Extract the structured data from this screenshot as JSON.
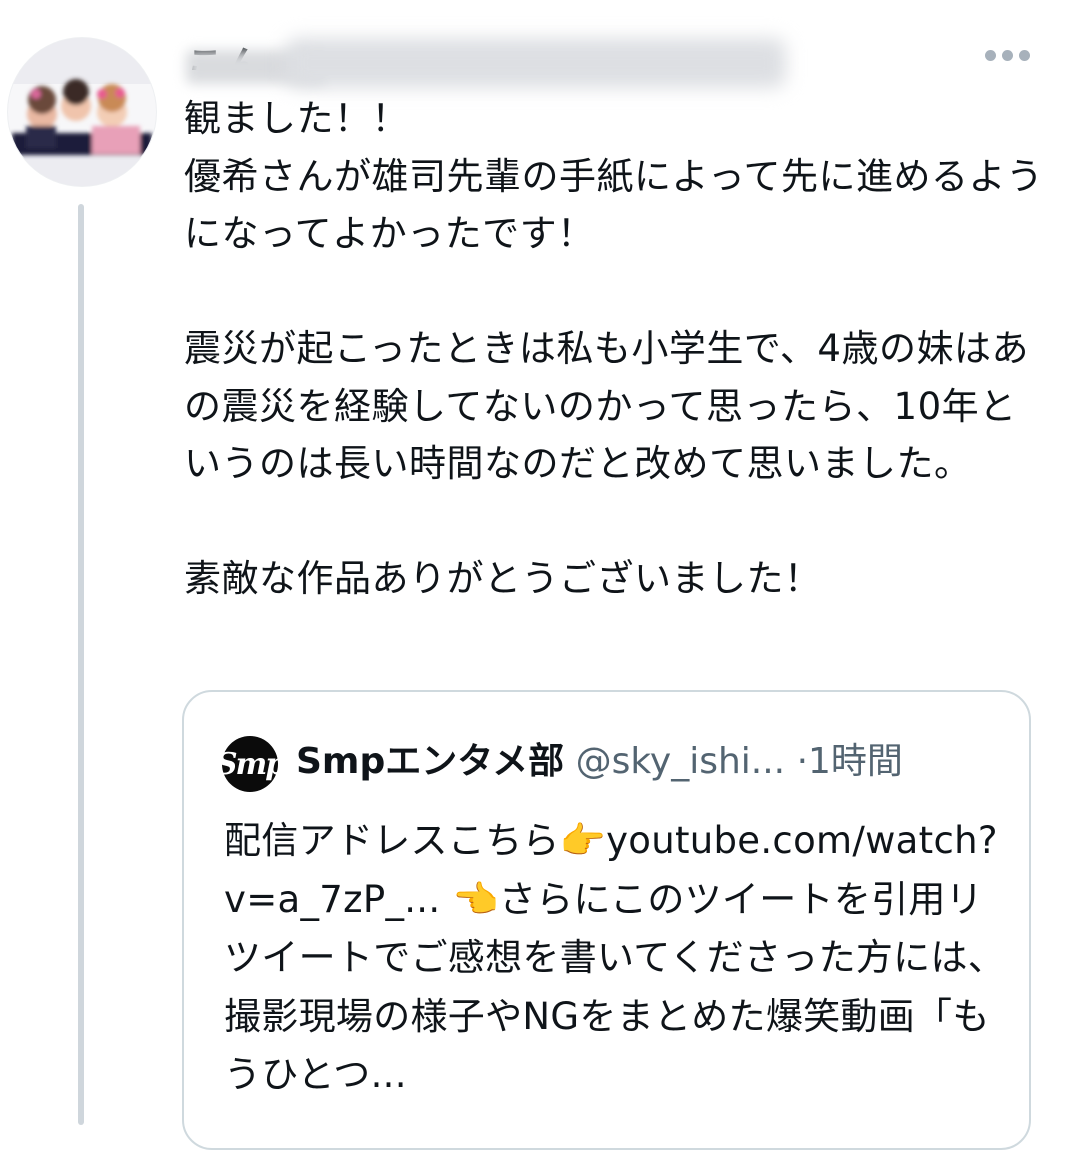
{
  "tweet": {
    "author_name_visible": "こん",
    "body": "観ました！！\n優希さんが雄司先輩の手紙によって先に進めるようになってよかったです！\n\n震災が起こったときは私も小学生で、4歳の妹はあの震災を経験してないのかって思ったら、10年というのは長い時間なのだと改めて思いました。\n\n素敵な作品ありがとうございました！",
    "avatar_icon": "profile-photo",
    "more_icon": "more-horizontal-icon"
  },
  "quote": {
    "name": "Smpエンタメ部",
    "handle": "@sky_ishi...",
    "separator": "·",
    "time": "1時間",
    "avatar_logo": "Smp",
    "text": "配信アドレスこちら👉youtube.com/watch?v=a_7zP_... 👈さらにこのツイートを引用リツイートでご感想を書いてくださった方には、撮影現場の様子やNGをまとめた爆笑動画「もうひとつ..."
  },
  "colors": {
    "text": "#0f1419",
    "secondary": "#536471",
    "border": "#cfd9de",
    "thread_line": "#cfd6dc"
  }
}
